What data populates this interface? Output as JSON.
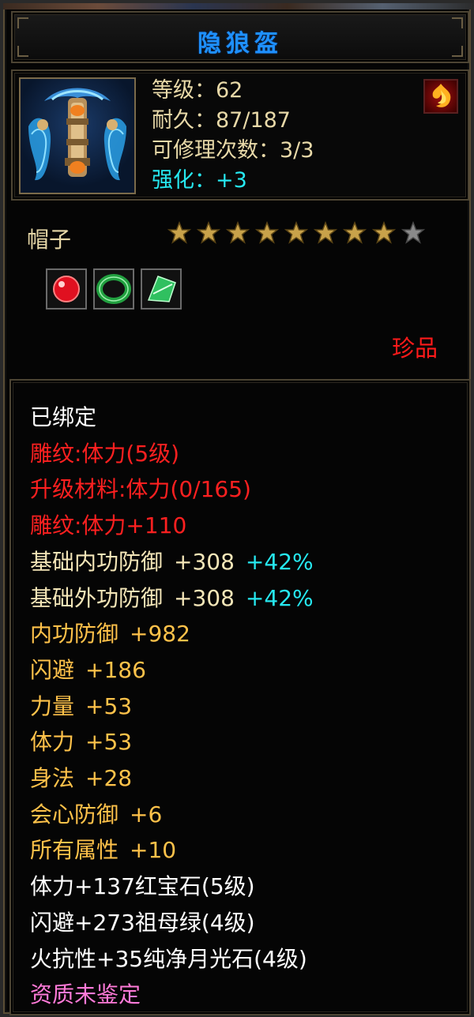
{
  "item": {
    "title": "隐狼盔",
    "level_label": "等级：62",
    "durability_label": "耐久：87/187",
    "repair_label": "可修理次数：3/3",
    "enhance_label": "强化：",
    "enhance_value": "+3",
    "name": "帽子",
    "stars_filled": 8,
    "stars_total": 9,
    "quality": "珍品",
    "icon": "helmet-icon",
    "class_icon": "flame-class-icon",
    "gem_slots": [
      {
        "icon": "ruby-gem-icon",
        "color": "#e01020"
      },
      {
        "icon": "emerald-ring-gem-icon",
        "color": "#22a040"
      },
      {
        "icon": "jade-shard-gem-icon",
        "color": "#30c060"
      }
    ]
  },
  "details": {
    "bound": "已绑定",
    "carving_level": "雕纹:体力(5级)",
    "upgrade_material": "升级材料:体力(0/165)",
    "carving_bonus": "雕纹:体力+110",
    "base_stats": [
      {
        "name": "基础内功防御",
        "value": "+308",
        "pct": "+42%"
      },
      {
        "name": "基础外功防御",
        "value": "+308",
        "pct": "+42%"
      }
    ],
    "attributes": [
      {
        "name": "内功防御",
        "value": "+982"
      },
      {
        "name": "闪避",
        "value": "+186"
      },
      {
        "name": "力量",
        "value": "+53"
      },
      {
        "name": "体力",
        "value": "+53"
      },
      {
        "name": "身法",
        "value": "+28"
      },
      {
        "name": "会心防御",
        "value": "+6"
      },
      {
        "name": "所有属性",
        "value": "+10"
      }
    ],
    "gems": [
      "体力+137红宝石(5级)",
      "闪避+273祖母绿(4级)",
      "火抗性+35纯净月光石(4级)"
    ],
    "aptitude": "资质未鉴定"
  },
  "colors": {
    "title": "#1e90ff",
    "red": "#ff2020",
    "gold": "#ffc24a",
    "cyan": "#26e8f0",
    "pink": "#ff7ad8",
    "frame": "#4c4433"
  }
}
